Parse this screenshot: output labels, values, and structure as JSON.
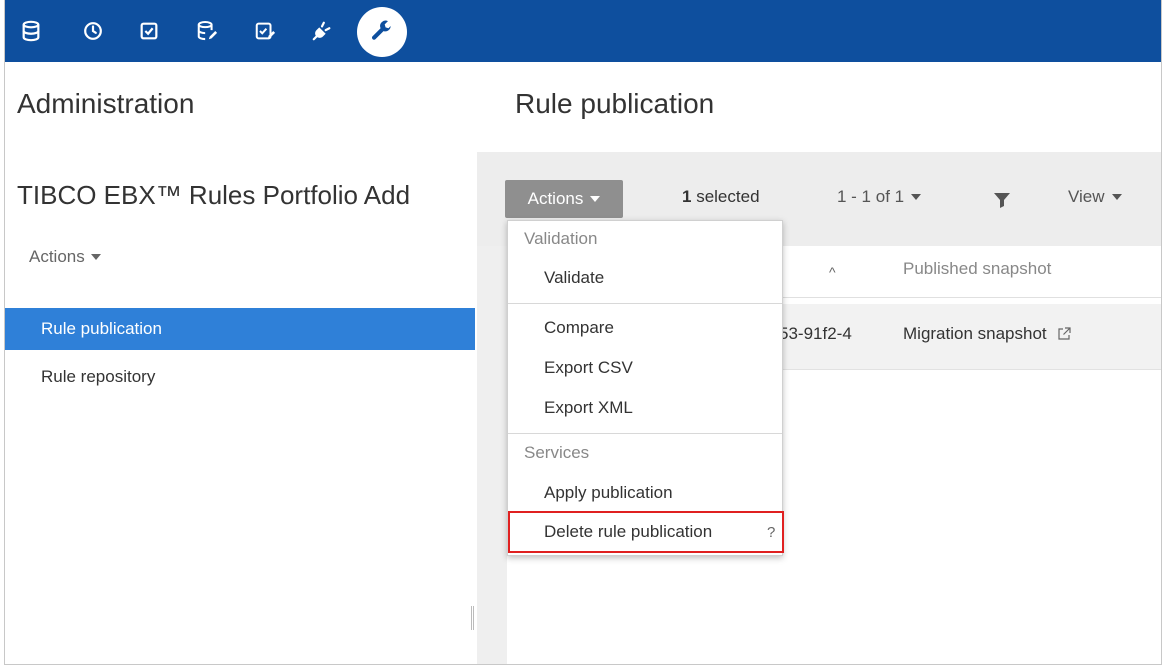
{
  "toolbar": {
    "icons": [
      "database-icon",
      "clock-icon",
      "checkbox-icon",
      "database-edit-icon",
      "checklist-edit-icon",
      "plug-icon",
      "wrench-icon"
    ],
    "accent": "#0e4f9e"
  },
  "left": {
    "title": "Administration",
    "subtitle": "TIBCO EBX™ Rules Portfolio Add",
    "actions_label": "Actions",
    "nav": [
      {
        "label": "Rule publication",
        "active": true
      },
      {
        "label": "Rule repository",
        "active": false
      }
    ]
  },
  "right": {
    "title": "Rule publication",
    "actions_label": "Actions",
    "selected_count": "1",
    "selected_label": "selected",
    "pager": "1 - 1 of 1",
    "view_label": "View",
    "table": {
      "sort_indicator": "^",
      "columns": [
        "Published snapshot"
      ],
      "rows": [
        {
          "id_fragment": "53-91f2-4",
          "snapshot": "Migration snapshot"
        }
      ]
    }
  },
  "menu": {
    "validation_header": "Validation",
    "validate": "Validate",
    "compare": "Compare",
    "export_csv": "Export CSV",
    "export_xml": "Export XML",
    "services_header": "Services",
    "apply": "Apply publication",
    "delete": "Delete rule publication",
    "help": "?"
  }
}
